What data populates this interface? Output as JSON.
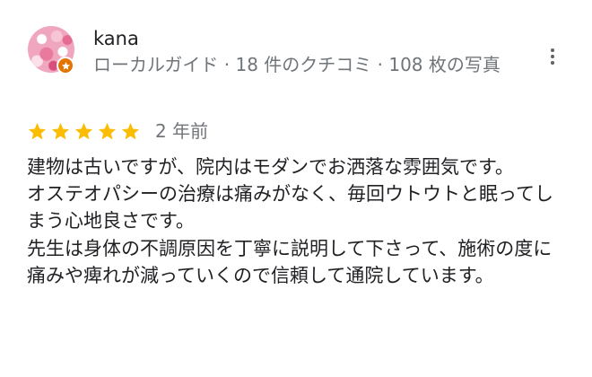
{
  "review": {
    "author": {
      "name": "kana",
      "meta": "ローカルガイド · 18 件のクチコミ · 108 枚の写真",
      "badge_icon": "local-guide-star",
      "avatar_icon": "pink-flowers-photo"
    },
    "rating": {
      "value": 5,
      "max": 5,
      "star_color": "#fbbc04"
    },
    "date": "2 年前",
    "more_icon": "more-vert",
    "text": {
      "paragraph_1": "建物は古いですが、院内はモダンでお洒落な雰囲気です。",
      "paragraph_2": "オステオパシーの治療は痛みがなく、毎回ウトウトと眠ってしまう心地良さです。",
      "paragraph_3": "先生は身体の不調原因を丁寧に説明して下さって、施術の度に痛みや痺れが減っていくので信頼して通院しています。"
    }
  }
}
